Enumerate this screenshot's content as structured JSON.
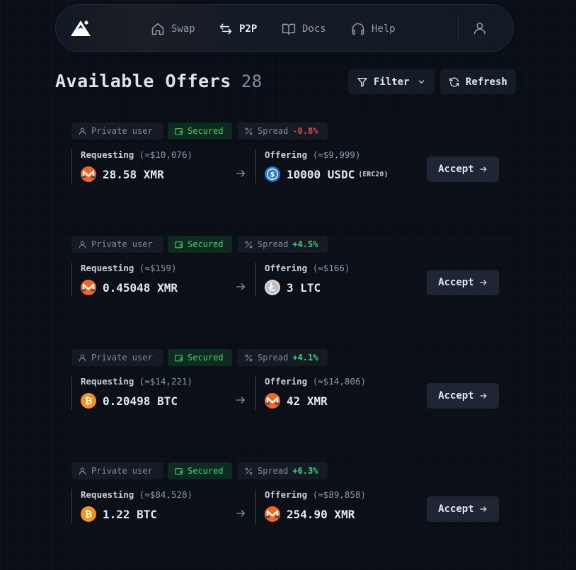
{
  "nav": {
    "items": [
      {
        "label": "Swap",
        "icon": "home-icon"
      },
      {
        "label": "P2P",
        "icon": "swap-arrows-icon",
        "active": true
      },
      {
        "label": "Docs",
        "icon": "book-icon"
      },
      {
        "label": "Help",
        "icon": "headphones-icon"
      }
    ],
    "user_icon": "user-icon"
  },
  "heading": {
    "title": "Available Offers",
    "count": "28"
  },
  "toolbar": {
    "filter_label": "Filter",
    "refresh_label": "Refresh"
  },
  "tags": {
    "user": "Private user",
    "secured": "Secured",
    "spread": "Spread"
  },
  "labels": {
    "requesting": "Requesting",
    "offering": "Offering",
    "accept": "Accept"
  },
  "offers": [
    {
      "spread": "-0.8%",
      "spread_sign": "neg",
      "requesting": {
        "usd": "(≈$10,076)",
        "amount": "28.58 XMR",
        "coin": "xmr"
      },
      "offering": {
        "usd": "(≈$9,999)",
        "amount": "10000 USDC",
        "sub": "(ERC20)",
        "coin": "usdc"
      }
    },
    {
      "spread": "+4.5%",
      "spread_sign": "pos",
      "requesting": {
        "usd": "(≈$159)",
        "amount": "0.45048 XMR",
        "coin": "xmr"
      },
      "offering": {
        "usd": "(≈$166)",
        "amount": "3 LTC",
        "coin": "ltc"
      }
    },
    {
      "spread": "+4.1%",
      "spread_sign": "pos",
      "requesting": {
        "usd": "(≈$14,221)",
        "amount": "0.20498 BTC",
        "coin": "btc"
      },
      "offering": {
        "usd": "(≈$14,806)",
        "amount": "42 XMR",
        "coin": "xmr"
      }
    },
    {
      "spread": "+6.3%",
      "spread_sign": "pos",
      "requesting": {
        "usd": "(≈$84,528)",
        "amount": "1.22 BTC",
        "coin": "btc"
      },
      "offering": {
        "usd": "(≈$89,858)",
        "amount": "254.90 XMR",
        "coin": "xmr"
      }
    }
  ],
  "colors": {
    "background": "#0a0e17",
    "secured_green": "#3ecf79",
    "negative_red": "#e04848",
    "xmr_orange": "#f26822",
    "btc_orange": "#f7931a",
    "usdc_blue": "#2775ca",
    "ltc_silver": "#bfbbbb"
  }
}
